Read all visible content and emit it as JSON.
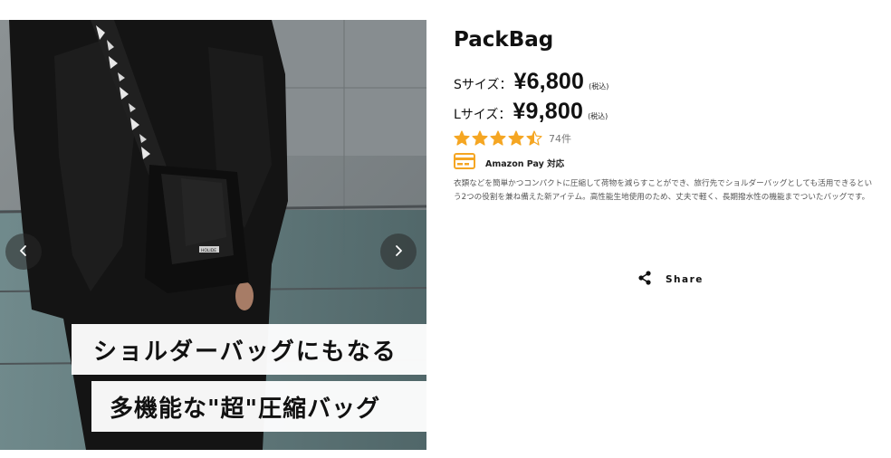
{
  "gallery": {
    "caption_line1": "ショルダーバッグにもなる",
    "caption_line2": "多機能な\"超\"圧縮バッグ",
    "bag_brand": "HOLIDE",
    "prev_icon": "chevron-left-icon",
    "next_icon": "chevron-right-icon"
  },
  "product": {
    "title": "PackBag",
    "prices": [
      {
        "size_label": "Sサイズ：",
        "price": "¥6,800",
        "tax_note": "(税込)"
      },
      {
        "size_label": "Lサイズ：",
        "price": "¥9,800",
        "tax_note": "(税込)"
      }
    ],
    "rating": {
      "value": 4.5,
      "max": 5,
      "review_count": "74件",
      "star_color": "#f5a623"
    },
    "payment": {
      "label": "Amazon Pay 対応",
      "icon": "credit-card-icon",
      "icon_color": "#f5a623"
    },
    "description": "衣類などを簡単かつコンパクトに圧縮して荷物を減らすことができ、旅行先でショルダーバッグとしても活用できるという2つの役割を兼ね備えた新アイテム。高性能生地使用のため、丈夫で軽く、長期撥水性の機能までついたバッグです。"
  },
  "share": {
    "label": "Share",
    "icon": "share-icon"
  }
}
